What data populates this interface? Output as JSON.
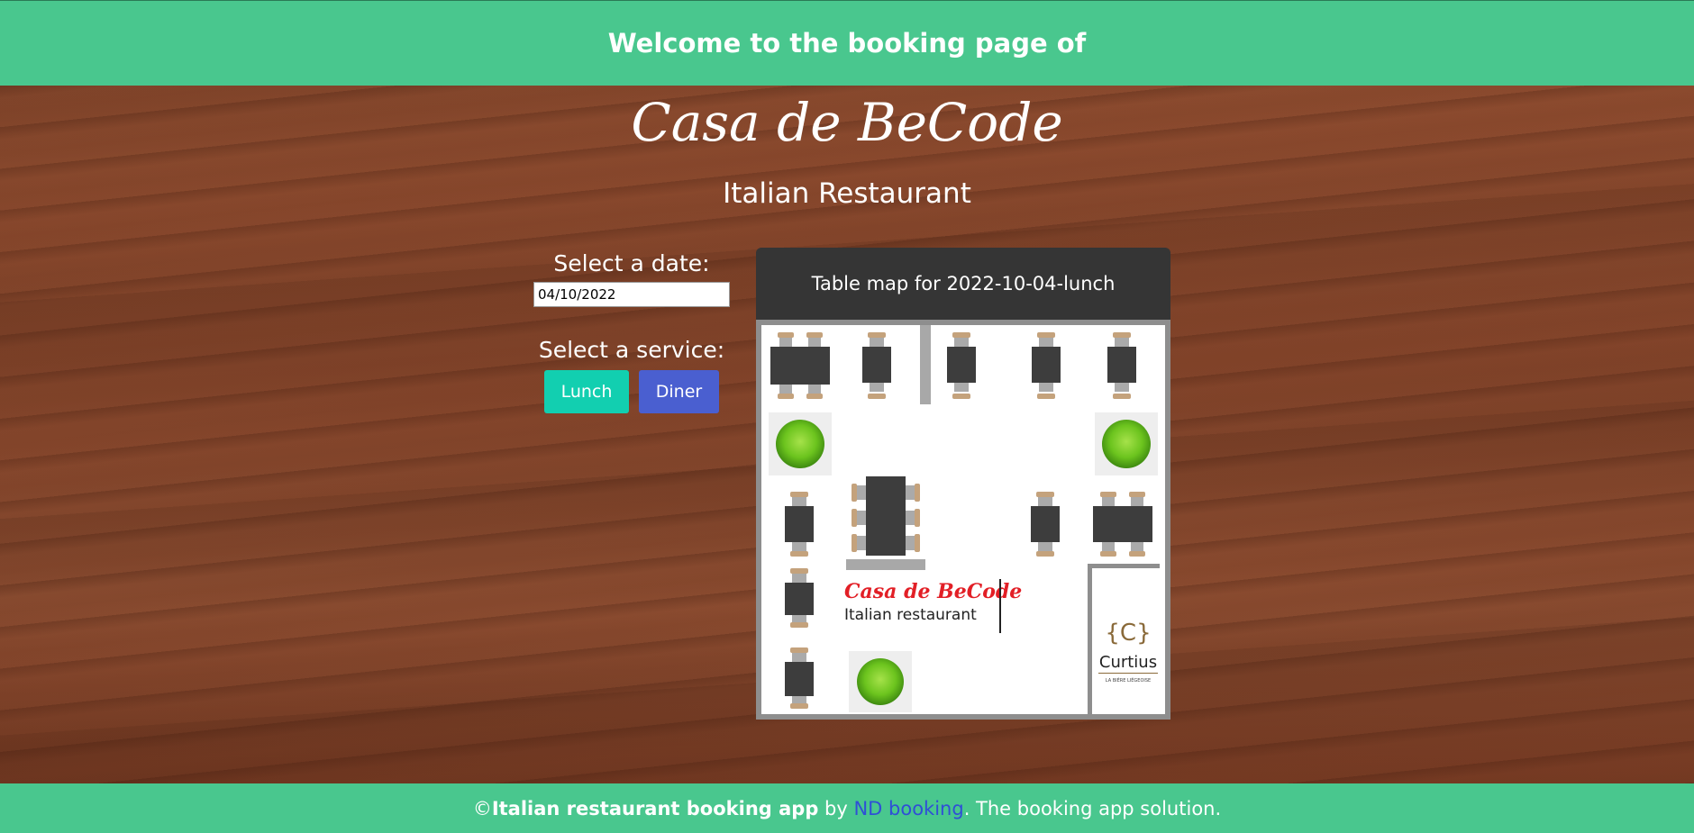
{
  "header": {
    "title": "Welcome to the booking page of"
  },
  "restaurant": {
    "name": "Casa de BeCode",
    "subtitle": "Italian Restaurant"
  },
  "booking": {
    "date_label": "Select a date:",
    "date_value": "04/10/2022",
    "service_label": "Select a service:",
    "lunch_label": "Lunch",
    "diner_label": "Diner"
  },
  "map": {
    "title": "Table map for 2022-10-04-lunch",
    "logo_name": "Casa de BeCode",
    "logo_sub": "Italian restaurant",
    "partner": "Curtius",
    "partner_sub": "LA BIÈRE LIÉGEOISE",
    "partner_mark": "{C}"
  },
  "footer": {
    "copyright": "© ",
    "app_name": "Italian restaurant booking app",
    "by": " by ",
    "link": "ND booking",
    "tagline": ". The booking app solution."
  },
  "colors": {
    "header_bg": "#49c78e",
    "lunch_btn": "#12cfb0",
    "diner_btn": "#4a5fd0",
    "map_header": "#353535"
  }
}
